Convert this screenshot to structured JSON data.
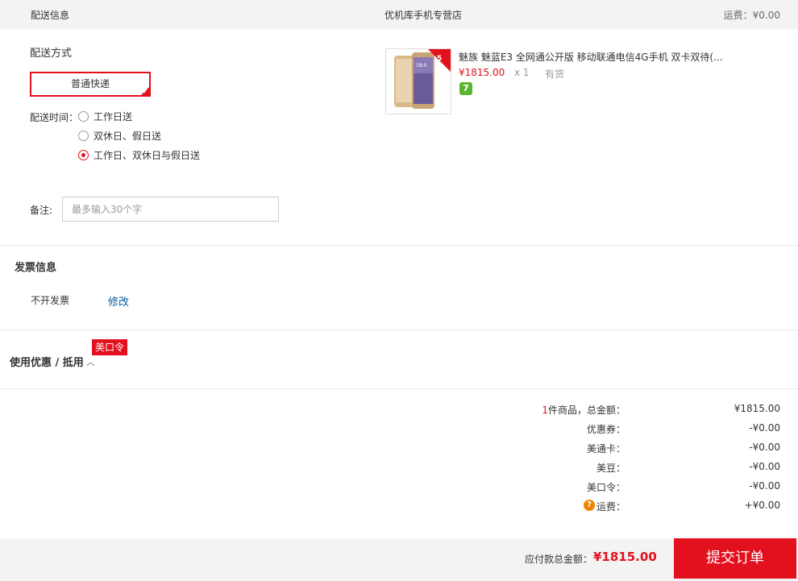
{
  "header": {
    "section_title": "配送信息",
    "store_name": "优机库手机专营店",
    "shipping_fee": "运费：¥0.00"
  },
  "delivery": {
    "method_label": "配送方式",
    "method_value": "普通快递",
    "time_label": "配送时间：",
    "time_options": [
      {
        "label": "工作日送",
        "selected": false
      },
      {
        "label": "双休日、假日送",
        "selected": false
      },
      {
        "label": "工作日、双休日与假日送",
        "selected": true
      }
    ],
    "remark_label": "备注:",
    "remark_placeholder": "最多输入30个字",
    "remark_value": ""
  },
  "product": {
    "title": "魅族 魅蓝E3 全网通公开版 移动联通电信4G手机 双卡双待(...",
    "price": "¥1815.00",
    "qty": "x 1",
    "stock": "有货",
    "badge": "7",
    "image_badge_color": "#e3101e"
  },
  "invoice": {
    "title": "发票信息",
    "value": "不开发票",
    "edit_label": "修改"
  },
  "coupon": {
    "title": "使用优惠 / 抵用",
    "chevron": "︿",
    "tag": "美口令"
  },
  "summary": {
    "count": "1",
    "count_suffix": "件商品，总金额：",
    "total": "¥1815.00",
    "rows": [
      {
        "label": "优惠券：",
        "value": "-¥0.00"
      },
      {
        "label": "美通卡：",
        "value": "-¥0.00"
      },
      {
        "label": "美豆：",
        "value": "-¥0.00"
      },
      {
        "label": "美口令：",
        "value": "-¥0.00"
      },
      {
        "label": "运费：",
        "value": "+¥0.00"
      }
    ],
    "help_icon": "?"
  },
  "footer": {
    "pay_label": "应付款总金额：",
    "pay_amount": "¥1815.00",
    "submit_label": "提交订单"
  },
  "colors": {
    "accent": "#e3101e",
    "link": "#005ea7",
    "badge_green": "#5cb531",
    "help_orange": "#f08300"
  }
}
